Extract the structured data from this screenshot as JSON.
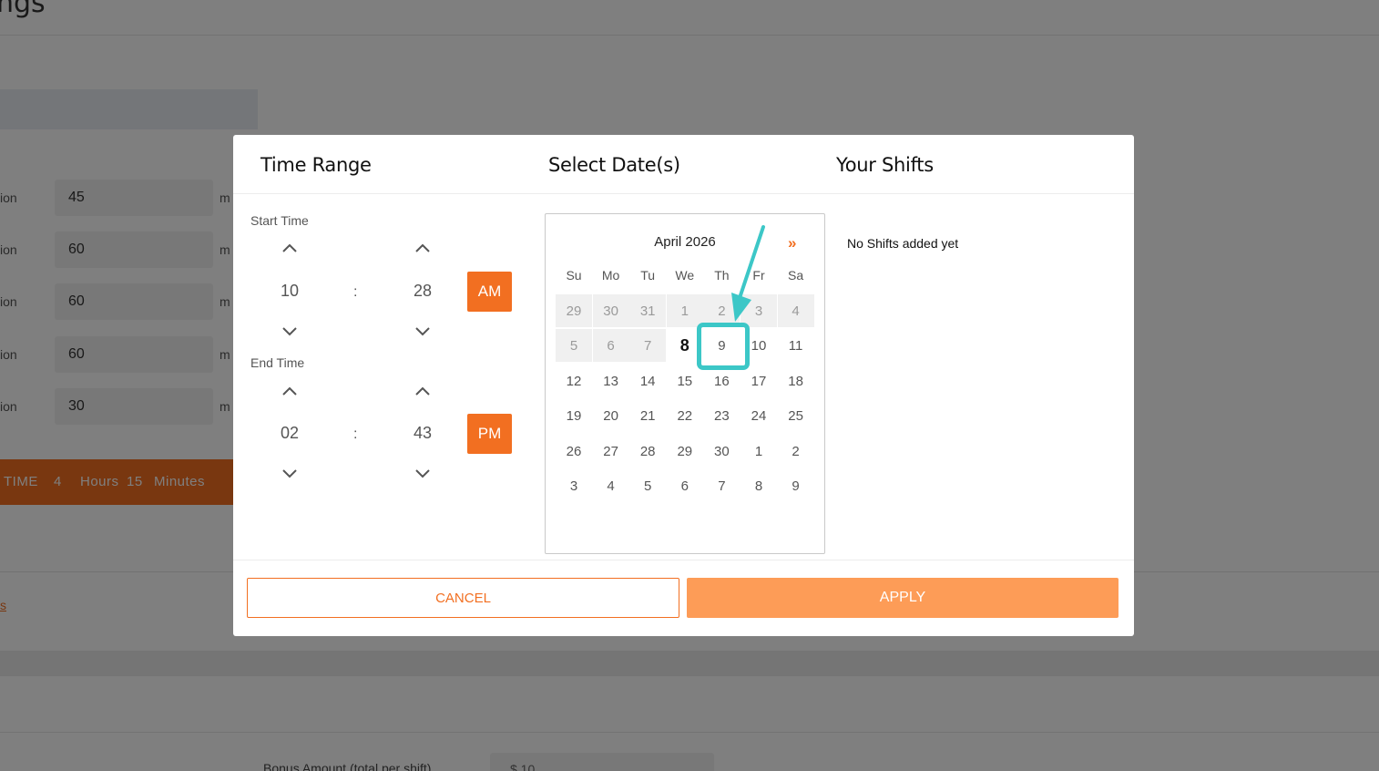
{
  "background": {
    "page_title": "ngs",
    "rows": [
      {
        "label": "ion",
        "value": "45",
        "unit": "m"
      },
      {
        "label": "ion",
        "value": "60",
        "unit": "m"
      },
      {
        "label": "ion",
        "value": "60",
        "unit": "m"
      },
      {
        "label": "ion",
        "value": "60",
        "unit": "m"
      },
      {
        "label": "ion",
        "value": "30",
        "unit": "m"
      }
    ],
    "total_bar": {
      "prefix": "TIME",
      "hours": "4",
      "hours_label": "Hours",
      "minutes": "15",
      "minutes_label": "Minutes"
    },
    "link_text": "s",
    "bonus_label": "Bonus Amount (total per shift)",
    "bonus_value": "$ 10"
  },
  "modal": {
    "headers": {
      "time_range": "Time Range",
      "select_dates": "Select Date(s)",
      "your_shifts": "Your Shifts"
    },
    "start": {
      "label": "Start Time",
      "hour": "10",
      "minute": "28",
      "period": "AM"
    },
    "end": {
      "label": "End Time",
      "hour": "02",
      "minute": "43",
      "period": "PM"
    },
    "separator": ":",
    "calendar": {
      "month_label": "April 2026",
      "next_icon": "»",
      "weekdays": [
        "Su",
        "Mo",
        "Tu",
        "We",
        "Th",
        "Fr",
        "Sa"
      ],
      "weeks": [
        [
          "29",
          "30",
          "31",
          "1",
          "2",
          "3",
          "4"
        ],
        [
          "5",
          "6",
          "7",
          "8",
          "9",
          "10",
          "11"
        ],
        [
          "12",
          "13",
          "14",
          "15",
          "16",
          "17",
          "18"
        ],
        [
          "19",
          "20",
          "21",
          "22",
          "23",
          "24",
          "25"
        ],
        [
          "26",
          "27",
          "28",
          "29",
          "30",
          "1",
          "2"
        ],
        [
          "3",
          "4",
          "5",
          "6",
          "7",
          "8",
          "9"
        ]
      ],
      "today": "8",
      "highlighted": "9"
    },
    "no_shifts_text": "No Shifts added yet",
    "cancel_label": "CANCEL",
    "apply_label": "APPLY"
  },
  "colors": {
    "accent": "#f26f21",
    "apply": "#fd9c57",
    "highlight": "#3cc7c7"
  }
}
